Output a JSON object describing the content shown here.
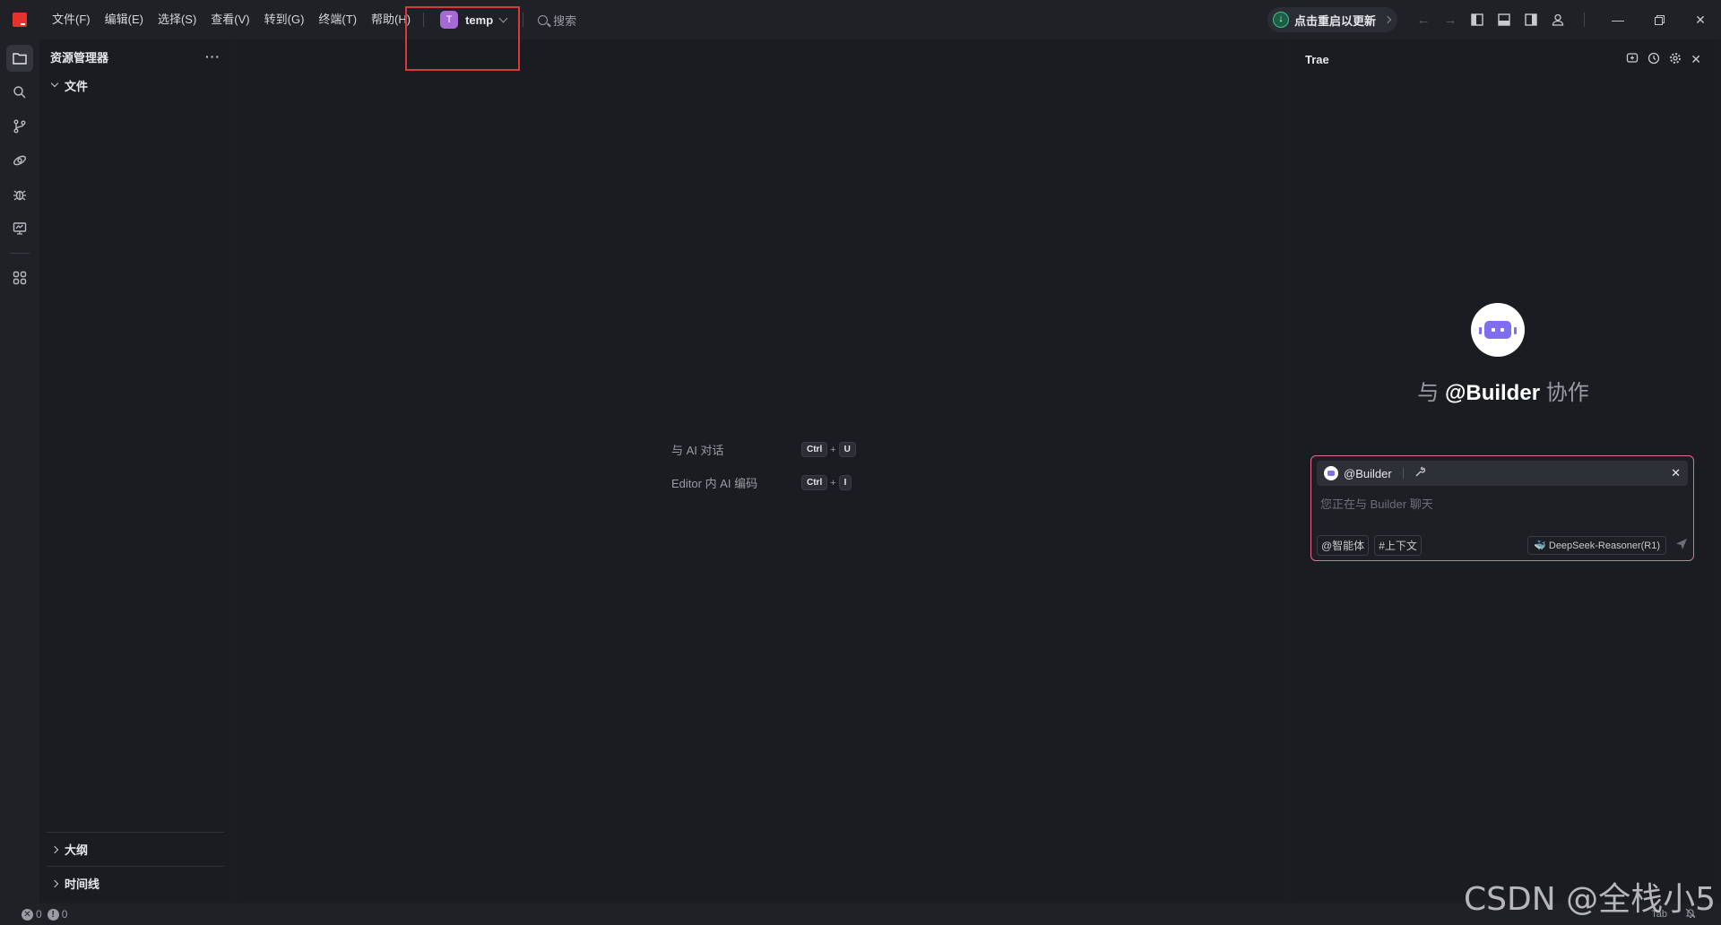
{
  "titlebar": {
    "menu": [
      "文件(F)",
      "编辑(E)",
      "选择(S)",
      "查看(V)",
      "转到(G)",
      "终端(T)",
      "帮助(H)"
    ],
    "project": {
      "badge": "T",
      "name": "temp"
    },
    "search_placeholder": "搜索",
    "update_label": "点击重启以更新",
    "icons": [
      "arrow-left-icon",
      "arrow-right-icon",
      "layout-left-icon",
      "layout-bottom-icon",
      "layout-right-icon",
      "account-icon"
    ],
    "window_controls": [
      "minimize",
      "restore",
      "close"
    ]
  },
  "activity_bar": {
    "items": [
      "explorer-icon",
      "search-icon",
      "source-control-icon",
      "remote-icon",
      "debug-icon",
      "test-icon",
      "extensions-icon"
    ]
  },
  "sidebar": {
    "title": "资源管理器",
    "more": "···",
    "tree_root": "文件",
    "sections": [
      "大纲",
      "时间线"
    ]
  },
  "editor": {
    "hints": [
      {
        "label": "与 AI 对话",
        "keys": [
          "Ctrl",
          "U"
        ]
      },
      {
        "label": "Editor 内 AI 编码",
        "keys": [
          "Ctrl",
          "I"
        ]
      }
    ]
  },
  "right_panel": {
    "title": "Trae",
    "collab_prefix": "与",
    "collab_agent": "@Builder",
    "collab_suffix": "协作",
    "chat": {
      "agent_chip": "@Builder",
      "placeholder": "您正在与 Builder 聊天",
      "agent_btn": "@智能体",
      "context_btn": "#上下文",
      "model": "DeepSeek-Reasoner(R1)"
    }
  },
  "statusbar": {
    "errors": "0",
    "warnings": "0",
    "right_label": "Tab"
  },
  "watermark": "CSDN @全栈小5",
  "colors": {
    "accent_pink": "#e76c8e",
    "bot_purple": "#7f6ff0",
    "highlight_red": "#d83a3a",
    "update_green": "#3fc28a"
  }
}
